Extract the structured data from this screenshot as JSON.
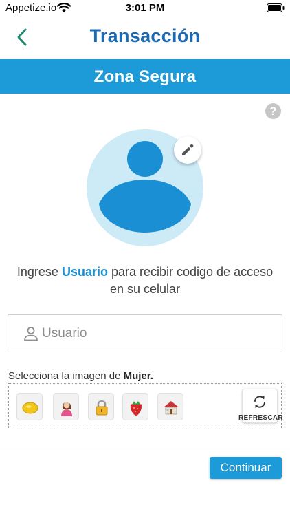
{
  "status_bar": {
    "carrier": "Appetize.io",
    "time": "3:01 PM",
    "icons": [
      "wifi-icon",
      "battery-icon"
    ]
  },
  "nav": {
    "title": "Transacción",
    "back_icon": "chevron-left-icon"
  },
  "banner": {
    "title": "Zona Segura"
  },
  "help": {
    "label": "?"
  },
  "avatar": {
    "icon": "user-silhouette-icon",
    "edit_icon": "pencil-icon"
  },
  "instructions": {
    "prefix": "Ingrese ",
    "highlight": "Usuario",
    "suffix": " para recibir codigo de acceso en su celular"
  },
  "user_field": {
    "value": "",
    "placeholder": "Usuario",
    "icon": "person-icon"
  },
  "image_select": {
    "prompt_prefix": "Selecciona la imagen de ",
    "prompt_target": "Mujer.",
    "options": [
      "lemon",
      "woman",
      "padlock",
      "strawberry",
      "house"
    ],
    "refresh_label": "REFRESCAR"
  },
  "continue_label": "Continuar",
  "colors": {
    "primary": "#1d9ad8",
    "title": "#1b6ab5",
    "back": "#1e8a70",
    "avatar_bg": "#cdeaf7",
    "avatar_fg": "#1b8fd3"
  }
}
